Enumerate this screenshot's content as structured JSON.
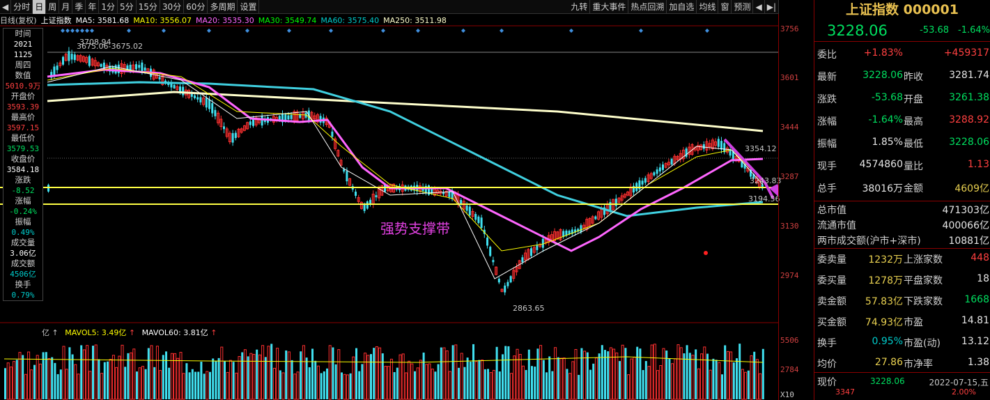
{
  "toolbar": {
    "left_items": [
      "◀",
      "分时",
      "日",
      "周",
      "月",
      "季",
      "年",
      "1分",
      "5分",
      "15分",
      "30分",
      "60分",
      "多周期",
      "设置"
    ],
    "active_index": 2,
    "right_items": [
      "九转",
      "重大事件",
      "热点回溯",
      "加自选",
      "均线",
      "窗",
      "预测",
      "◀",
      "▶|"
    ]
  },
  "ma_row": {
    "prefix": "日线(复权)",
    "name": "上证指数",
    "ma5": "MA5: 3581.68",
    "ma10": "MA10: 3556.07",
    "ma20": "MA20: 3535.30",
    "ma30": "MA30: 3549.74",
    "ma60": "MA60: 3575.40",
    "ma250": "MA250: 3511.98",
    "colors": {
      "ma5": "#ffffff",
      "ma10": "#ffff00",
      "ma20": "#ff66ff",
      "ma30": "#00ff00",
      "ma60": "#00cccc",
      "ma250": "#ffffcc"
    }
  },
  "info_strip": [
    {
      "label": "时间",
      "value": "2021",
      "color": "#ffffff"
    },
    {
      "label": "",
      "value": "1125",
      "color": "#ffffff"
    },
    {
      "label": "周四",
      "value": "",
      "color": "#ffffff"
    },
    {
      "label": "数值",
      "value": "5010.9万",
      "color": "#ff4040"
    },
    {
      "label": "开盘价",
      "value": "3593.39",
      "color": "#ff4040"
    },
    {
      "label": "最高价",
      "value": "3597.15",
      "color": "#ff4040"
    },
    {
      "label": "最低价",
      "value": "3579.53",
      "color": "#00e060"
    },
    {
      "label": "收盘价",
      "value": "3584.18",
      "color": "#ffffff"
    },
    {
      "label": "涨跌",
      "value": "-8.52",
      "color": "#00e060"
    },
    {
      "label": "涨幅",
      "value": "-0.24%",
      "color": "#00e060"
    },
    {
      "label": "振幅",
      "value": "0.49%",
      "color": "#00cccc"
    },
    {
      "label": "成交量",
      "value": "3.06亿",
      "color": "#ffffff"
    },
    {
      "label": "成交额",
      "value": "4506亿",
      "color": "#00cccc"
    },
    {
      "label": "换手",
      "value": "0.79%",
      "color": "#00cccc"
    }
  ],
  "price_axis": [
    "3756",
    "3601",
    "3444",
    "3287",
    "3130",
    "2974"
  ],
  "volume_axis": [
    "5506",
    "2784"
  ],
  "x10": "X10",
  "annotations": {
    "high_label": "3708.94",
    "high2_label": "3675.06-3675.02",
    "low_label": "2863.65",
    "peak_right": "3354.12",
    "mid_right": "3243.83",
    "near_right": "3194.56",
    "support_text": "强势支撑带"
  },
  "volume_row": {
    "mavol5": "MAVOL5: 3.49亿",
    "mavol60": "MAVOL60: 3.81亿"
  },
  "right_panel": {
    "title": "上证指数 000001",
    "price": "3228.06",
    "change": "-53.68",
    "change_pct": "-1.64%",
    "rows": [
      {
        "l1": "委比",
        "v1": "+1.83%",
        "c1": "#ff4040",
        "l2": "",
        "v2": "+459317",
        "c2": "#ff4040"
      },
      {
        "l1": "最新",
        "v1": "3228.06",
        "c1": "#00e060",
        "l2": "昨收",
        "v2": "3281.74",
        "c2": "#e6e6e6"
      },
      {
        "l1": "涨跌",
        "v1": "-53.68",
        "c1": "#00e060",
        "l2": "开盘",
        "v2": "3261.38",
        "c2": "#00e060"
      },
      {
        "l1": "涨幅",
        "v1": "-1.64%",
        "c1": "#00e060",
        "l2": "最高",
        "v2": "3288.92",
        "c2": "#ff4040"
      },
      {
        "l1": "振幅",
        "v1": "1.85%",
        "c1": "#e6e6e6",
        "l2": "最低",
        "v2": "3228.06",
        "c2": "#00e060"
      },
      {
        "l1": "现手",
        "v1": "4574860",
        "c1": "#e6e6e6",
        "l2": "量比",
        "v2": "1.13",
        "c2": "#ff4040"
      },
      {
        "l1": "总手",
        "v1": "38016万",
        "c1": "#e6e6e6",
        "l2": "金额",
        "v2": "4609亿",
        "c2": "#e8d050"
      }
    ],
    "market_rows": [
      {
        "label": "总市值",
        "value": "471303亿"
      },
      {
        "label": "流通市值",
        "value": "400066亿"
      },
      {
        "label": "两市成交额(沪市+深市)",
        "value": "10881亿"
      }
    ],
    "bottom_rows": [
      {
        "l1": "委卖量",
        "v1": "1232万",
        "c1": "#e8d050",
        "l2": "上涨家数",
        "v2": "448",
        "c2": "#ff4040"
      },
      {
        "l1": "委买量",
        "v1": "1278万",
        "c1": "#e8d050",
        "l2": "平盘家数",
        "v2": "18",
        "c2": "#e6e6e6"
      },
      {
        "l1": "卖金额",
        "v1": "57.83亿",
        "c1": "#e8d050",
        "l2": "下跌家数",
        "v2": "1668",
        "c2": "#00e060"
      },
      {
        "l1": "买金额",
        "v1": "74.93亿",
        "c1": "#e8d050",
        "l2": "市盈",
        "v2": "14.81",
        "c2": "#e6e6e6"
      },
      {
        "l1": "换手",
        "v1": "0.95%",
        "c1": "#00cccc",
        "l2": "市盈(动)",
        "v2": "13.12",
        "c2": "#e6e6e6"
      },
      {
        "l1": "均价",
        "v1": "27.86",
        "c1": "#e8d050",
        "l2": "市净率",
        "v2": "1.38",
        "c2": "#e6e6e6"
      }
    ],
    "footer_label": "现价",
    "footer_price": "3228.06",
    "footer_date": "2022-07-15,五",
    "footer_sub_left": "3347",
    "footer_sub_right": "2.00%"
  }
}
